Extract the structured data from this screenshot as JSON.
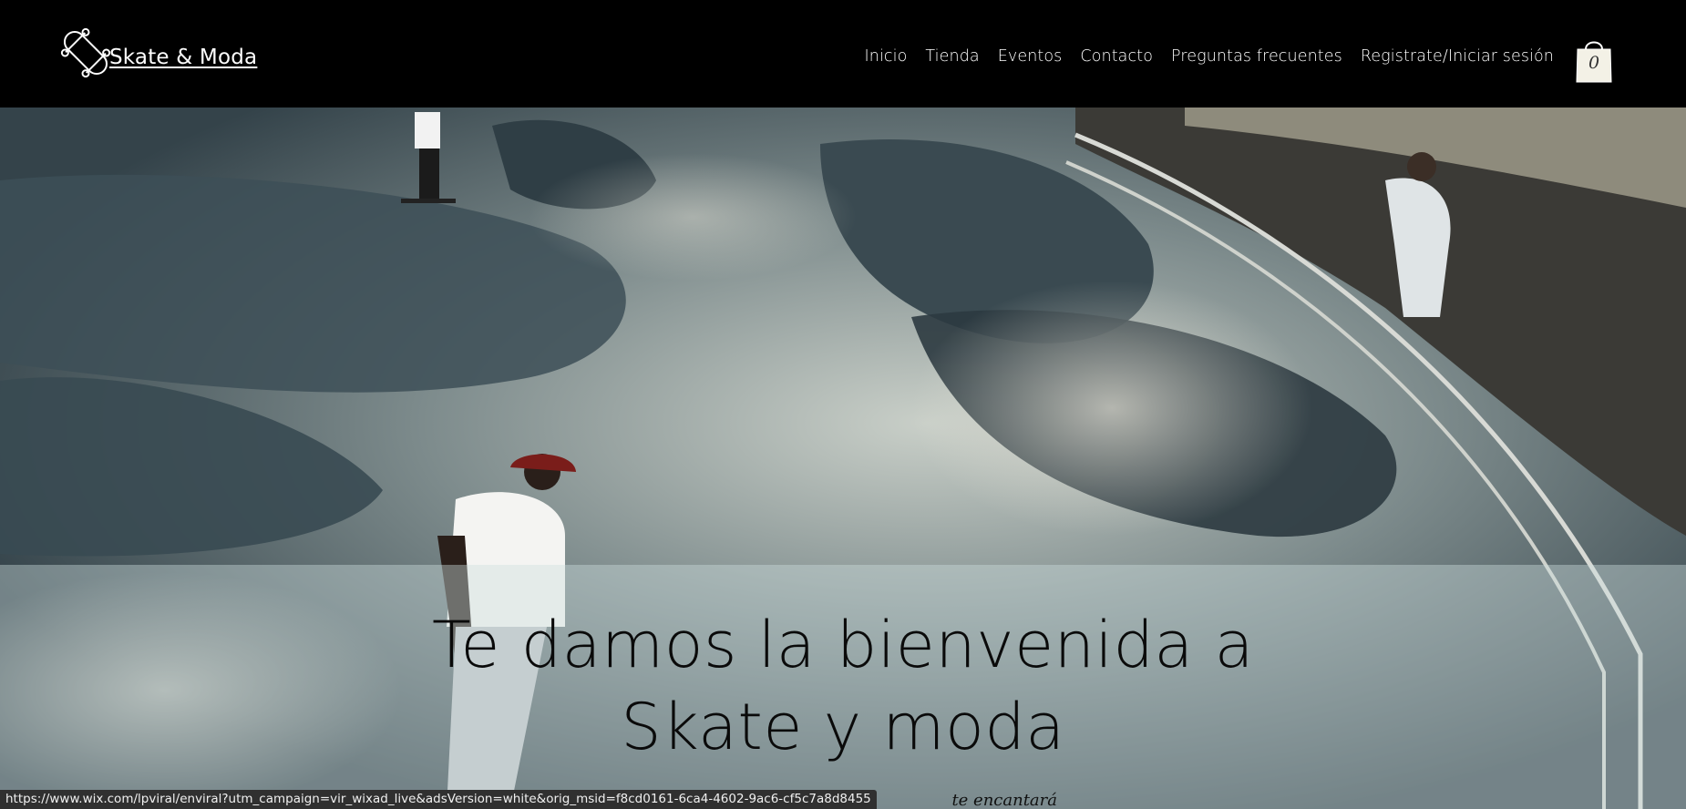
{
  "header": {
    "site_name": "Skate & Moda",
    "nav": [
      {
        "label": "Inicio"
      },
      {
        "label": "Tienda"
      },
      {
        "label": "Eventos"
      },
      {
        "label": "Contacto"
      },
      {
        "label": "Preguntas frecuentes"
      },
      {
        "label": "Registrate/Iniciar sesión"
      }
    ],
    "cart_count": "0"
  },
  "hero": {
    "title_line1": "Te damos la bienvenida a",
    "title_line2": "Skate y moda",
    "subtitle": "te encantará",
    "image": "skatepark-photo"
  },
  "status_bar": {
    "url": "https://www.wix.com/lpviral/enviral?utm_campaign=vir_wixad_live&adsVersion=white&orig_msid=f8cd0161-6ca4-4602-9ac6-cf5c7a8d8455"
  },
  "colors": {
    "header_bg": "#000000",
    "header_text": "#ffffff",
    "panel_overlay": "#cddede",
    "title_text": "#0a0a0a"
  }
}
